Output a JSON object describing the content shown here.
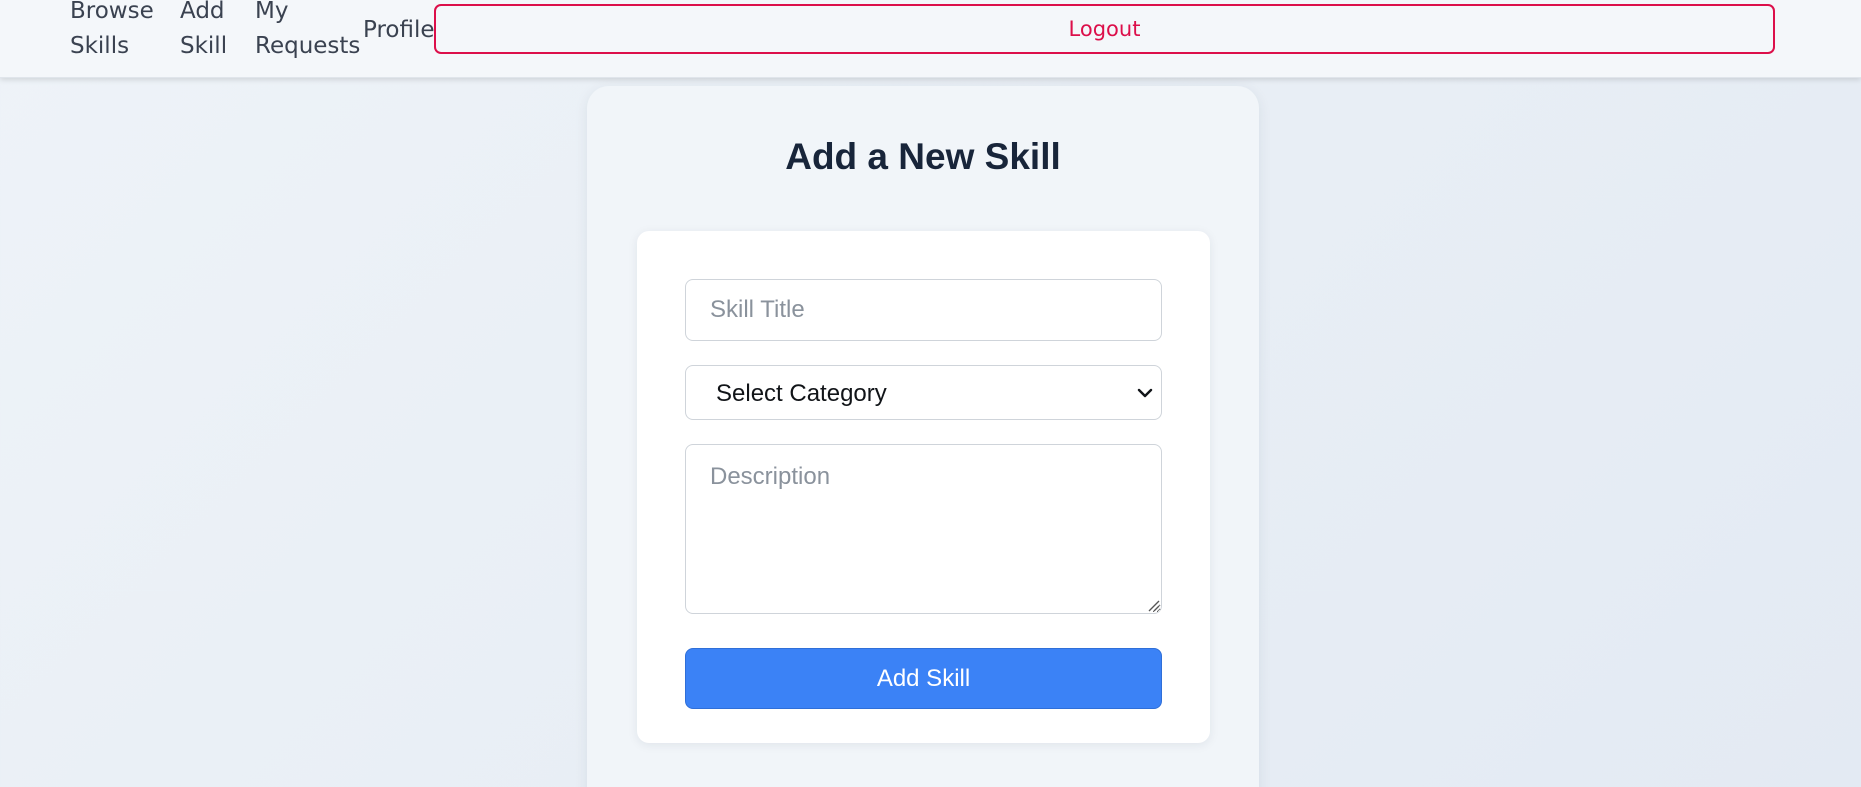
{
  "nav": {
    "links": [
      {
        "label": "Browse Skills"
      },
      {
        "label": "Add Skill"
      },
      {
        "label": "My Requests"
      },
      {
        "label": "Profile"
      }
    ],
    "logout_label": "Logout"
  },
  "form": {
    "heading": "Add a New Skill",
    "title_placeholder": "Skill Title",
    "category_selected": "Select Category",
    "description_placeholder": "Description",
    "submit_label": "Add Skill"
  },
  "colors": {
    "accent_blue": "#3b82f6",
    "logout_red": "#dc0f4a",
    "heading_text": "#18253a"
  }
}
